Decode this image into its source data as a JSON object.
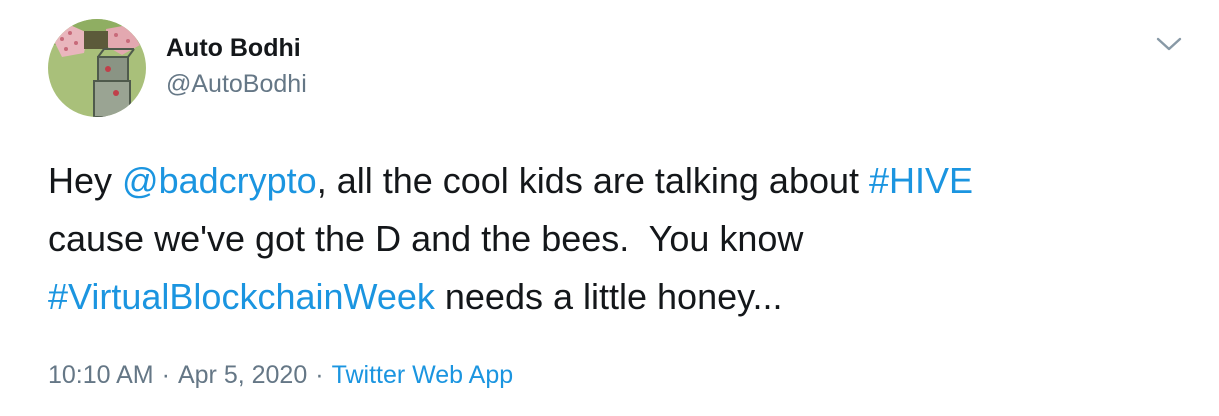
{
  "tweet": {
    "author": {
      "display_name": "Auto Bodhi",
      "handle": "@AutoBodhi"
    },
    "text": {
      "line1": {
        "prefix": "Hey ",
        "mention": "@badcrypto",
        "middle": ", all the cool kids are talking about ",
        "hashtag": "#HIVE"
      },
      "line2": "cause we've got the D and the bees.  You know",
      "line3": {
        "hashtag": "#VirtualBlockchainWeek",
        "suffix": " needs a little honey..."
      }
    },
    "meta": {
      "time": "10:10 AM",
      "separator": "·",
      "date": "Apr 5, 2020",
      "source": "Twitter Web App"
    }
  },
  "icons": {
    "caret": "chevron-down-icon",
    "avatar": "avatar"
  },
  "colors": {
    "link": "#1b95e0",
    "secondary_text": "#657786",
    "primary_text": "#14171a",
    "background": "#ffffff"
  }
}
